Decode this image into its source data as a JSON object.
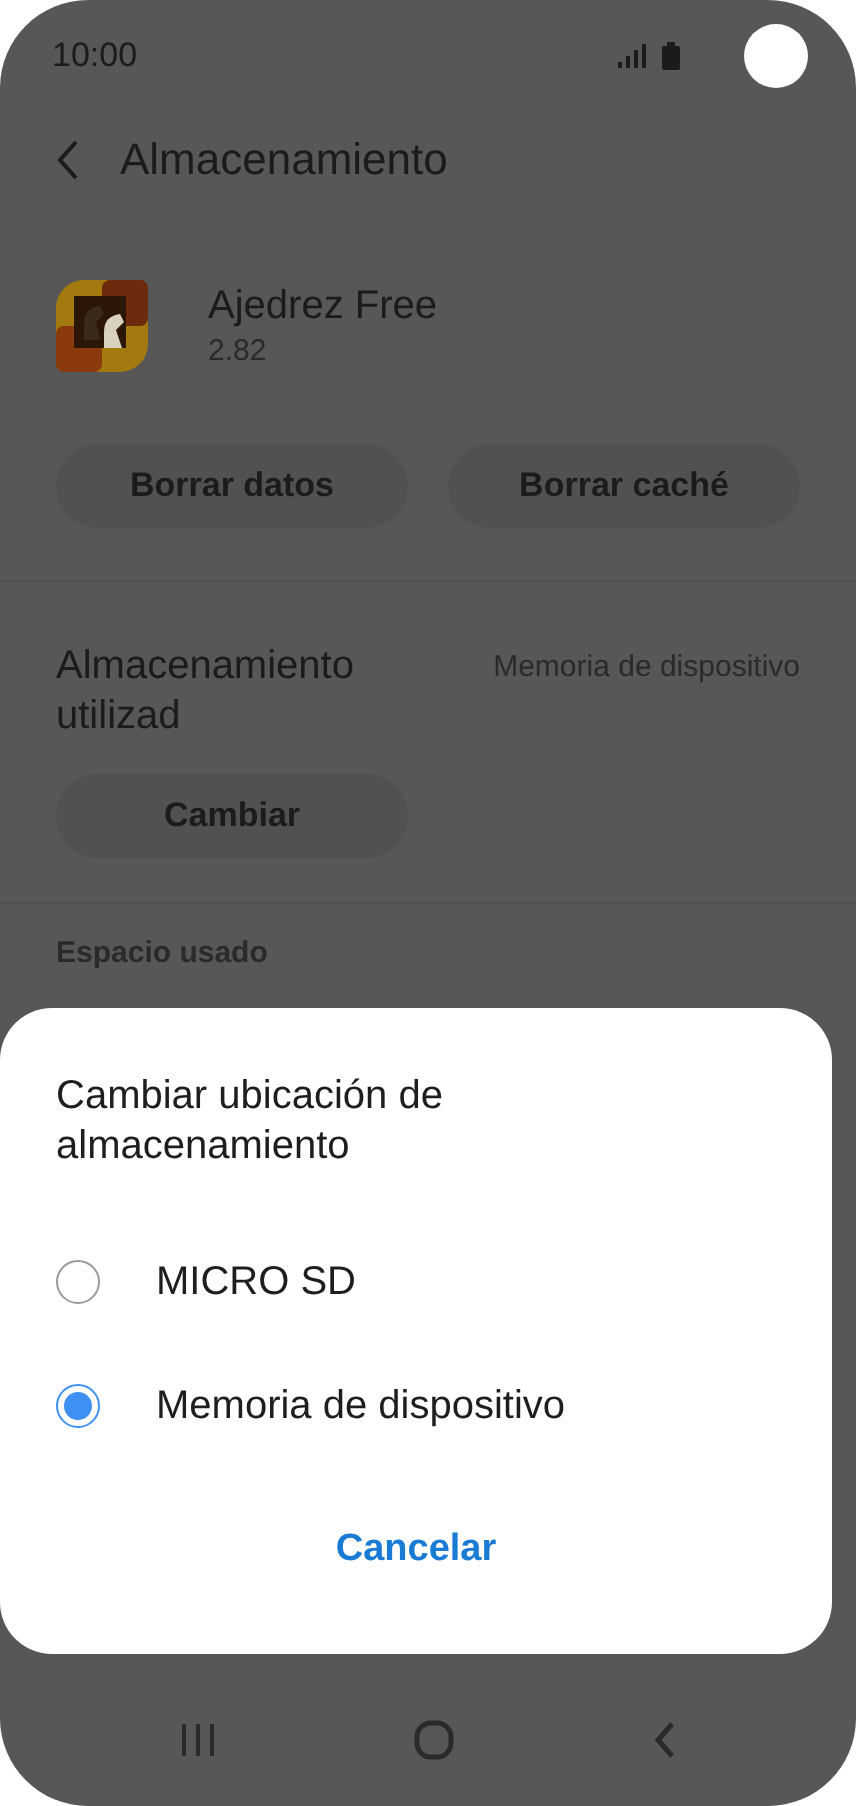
{
  "status_bar": {
    "time": "10:00"
  },
  "header": {
    "title": "Almacenamiento"
  },
  "app": {
    "name": "Ajedrez Free",
    "version": "2.82"
  },
  "actions": [
    "Borrar datos",
    "Borrar caché"
  ],
  "storage": {
    "label": "Almacenamiento utilizad",
    "value": "Memoria de dispositivo",
    "button": "Cambiar"
  },
  "section_heading": "Espacio usado",
  "dialog": {
    "title": "Cambiar ubicación de almacenamiento",
    "options": [
      {
        "label": "MICRO SD",
        "selected": false
      },
      {
        "label": "Memoria de dispositivo",
        "selected": true
      }
    ],
    "cancel": "Cancelar"
  }
}
